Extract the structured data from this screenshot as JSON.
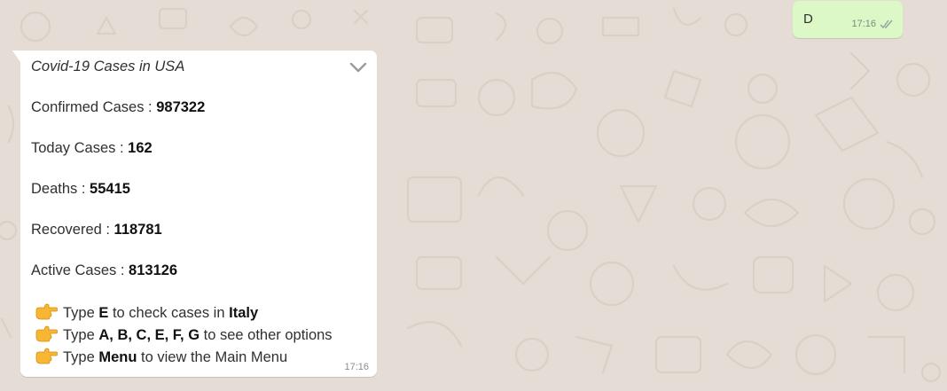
{
  "outgoing": {
    "text": "D",
    "time": "17:16",
    "status_icon": "double-check-icon"
  },
  "incoming": {
    "title": "Covid-19 Cases in USA",
    "stats": [
      {
        "label": "Confirmed Cases : ",
        "value": "987322"
      },
      {
        "label": "Today Cases : ",
        "value": "162"
      },
      {
        "label": "Deaths : ",
        "value": "55415"
      },
      {
        "label": "Recovered : ",
        "value": "118781"
      },
      {
        "label": "Active Cases : ",
        "value": "813126"
      }
    ],
    "options": [
      {
        "pre": "Type ",
        "key": "E",
        "mid": " to check cases in ",
        "target": "Italy",
        "post": ""
      },
      {
        "pre": "Type ",
        "key": "A, B, C, E, F, G",
        "mid": " to see other options",
        "target": "",
        "post": ""
      },
      {
        "pre": "Type ",
        "key": "Menu",
        "mid": " to view the Main Menu",
        "target": "",
        "post": ""
      }
    ],
    "option_icon": "pointing-hand-icon",
    "time": "17:16",
    "menu_icon": "chevron-down-icon"
  },
  "colors": {
    "chat_background": "#e5ddd5",
    "outgoing_bubble": "#dcf8c6",
    "incoming_bubble": "#ffffff",
    "emoji_hand": "#f7b732"
  }
}
